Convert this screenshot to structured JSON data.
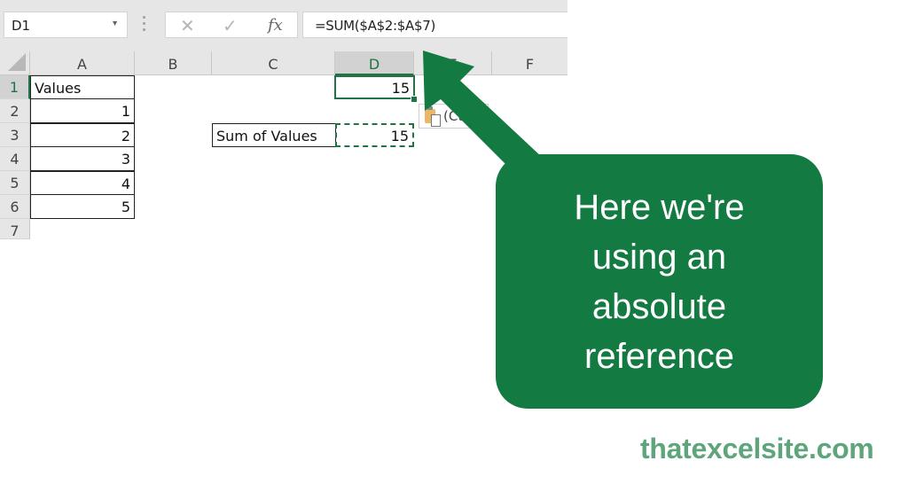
{
  "excel": {
    "name_box": "D1",
    "formula_bar": {
      "cancel_icon": "✕",
      "enter_icon": "✓",
      "fx_label": "fx",
      "formula": "=SUM($A$2:$A$7)"
    },
    "columns": [
      "A",
      "B",
      "C",
      "D",
      "E",
      "F"
    ],
    "selected_column": "D",
    "rows": [
      "1",
      "2",
      "3",
      "4",
      "5",
      "6",
      "7"
    ],
    "selected_row": "1",
    "cells": {
      "A1": "Values",
      "A2": "1",
      "A3": "2",
      "A4": "3",
      "A5": "4",
      "A6": "5",
      "C3": "Sum of Values",
      "D1": "15",
      "D3": "15"
    },
    "paste_options_label": "(Ctrl)"
  },
  "callout": {
    "text": "Here we're using an absolute reference",
    "color": "#137a42"
  },
  "brand": {
    "text": "thatexcelsite.com",
    "color": "#5ea57c"
  },
  "colors": {
    "excel_green": "#217346"
  }
}
